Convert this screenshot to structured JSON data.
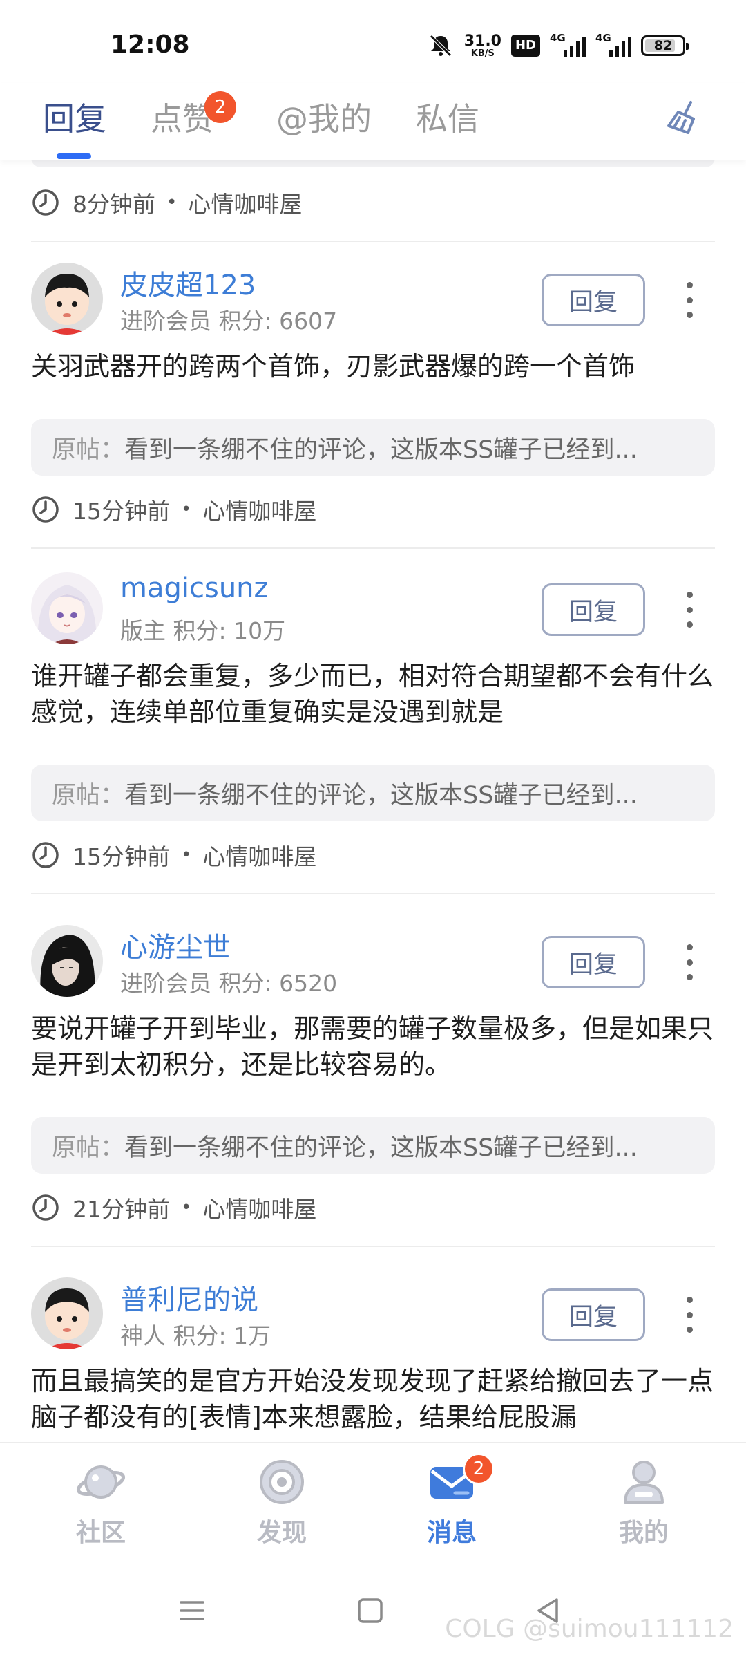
{
  "status_bar": {
    "time": "12:08",
    "speed_value": "31.0",
    "speed_unit": "KB/S",
    "hd": "HD",
    "net1": "4G",
    "net2": "4G",
    "battery": "82",
    "battery_level": 0.82,
    "icons": [
      "mute-bell-icon",
      "hd-icon",
      "signal-icon",
      "signal-icon",
      "battery-icon"
    ]
  },
  "tabs": {
    "items": [
      {
        "label": "回复",
        "active": true
      },
      {
        "label": "点赞",
        "badge": "2"
      },
      {
        "label": "@我的"
      },
      {
        "label": "私信"
      }
    ],
    "clear_icon": "broom-icon"
  },
  "first_meta": {
    "time": "8分钟前",
    "board": "心情咖啡屋"
  },
  "posts": [
    {
      "username": "皮皮超123",
      "level": "进阶会员",
      "points": "积分: 6607",
      "reply_label": "回复",
      "content": "关羽武器开的跨两个首饰，刃影武器爆的跨一个首饰",
      "orig_prefix": "原帖：",
      "orig_text": "看到一条绷不住的评论，这版本SS罐子已经到...",
      "time": "15分钟前",
      "board": "心情咖啡屋"
    },
    {
      "username": "magicsunz",
      "level": "版主",
      "points": "积分: 10万",
      "reply_label": "回复",
      "content": "谁开罐子都会重复，多少而已，相对符合期望都不会有什么感觉，连续单部位重复确实是没遇到就是",
      "orig_prefix": "原帖：",
      "orig_text": "看到一条绷不住的评论，这版本SS罐子已经到...",
      "time": "15分钟前",
      "board": "心情咖啡屋"
    },
    {
      "username": "心游尘世",
      "level": "进阶会员",
      "points": "积分: 6520",
      "reply_label": "回复",
      "content": "要说开罐子开到毕业，那需要的罐子数量极多，但是如果只是开到太初积分，还是比较容易的。",
      "orig_prefix": "原帖：",
      "orig_text": "看到一条绷不住的评论，这版本SS罐子已经到...",
      "time": "21分钟前",
      "board": "心情咖啡屋"
    },
    {
      "username": "普利尼的说",
      "level": "神人",
      "points": "积分: 1万",
      "reply_label": "回复",
      "content": "而且最搞笑的是官方开始没发现发现了赶紧给撤回去了一点脑子都没有的[表情]本来想露脸，结果给屁股漏"
    }
  ],
  "bottom_nav": {
    "items": [
      {
        "label": "社区",
        "icon": "planet-icon"
      },
      {
        "label": "发现",
        "icon": "discover-icon"
      },
      {
        "label": "消息",
        "icon": "mail-icon",
        "active": true,
        "badge": "2"
      },
      {
        "label": "我的",
        "icon": "profile-icon"
      }
    ]
  },
  "watermark": "@suimou111112",
  "watermark_logo": "COLG",
  "colors": {
    "accent": "#3f7bdc",
    "badge": "#f2552c",
    "username": "#3d7dd6"
  }
}
